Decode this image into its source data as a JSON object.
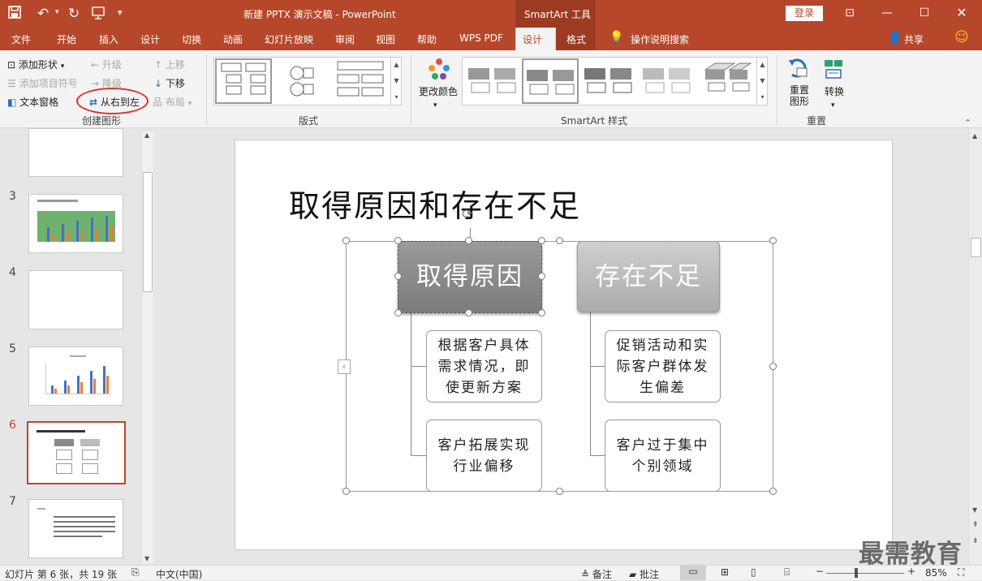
{
  "titlebar": {
    "document_title": "新建 PPTX 演示文稿  -  PowerPoint",
    "context_group": "SmartArt 工具",
    "login": "登录"
  },
  "tabs": [
    "文件",
    "开始",
    "插入",
    "设计",
    "切换",
    "动画",
    "幻灯片放映",
    "审阅",
    "视图",
    "帮助",
    "WPS PDF",
    "设计",
    "格式"
  ],
  "tell_me": "操作说明搜索",
  "share": "共享",
  "ribbon": {
    "create": {
      "add_shape": "添加形状",
      "add_bullet": "添加项目符号",
      "text_pane": "文本窗格",
      "promote": "升级",
      "demote": "降级",
      "rtl": "从右到左",
      "move_up": "上移",
      "move_down": "下移",
      "layout": "布局",
      "label": "创建图形"
    },
    "layouts_label": "版式",
    "change_colors": "更改颜色",
    "styles_label": "SmartArt 样式",
    "reset_graphic": "重置图形",
    "reset_graphic_l1": "重置",
    "reset_graphic_l2": "图形",
    "convert": "转换",
    "reset_label": "重置"
  },
  "thumbnails": [
    {
      "num": "3"
    },
    {
      "num": "4"
    },
    {
      "num": "5"
    },
    {
      "num": "6"
    },
    {
      "num": "7"
    }
  ],
  "slide": {
    "title": "取得原因和存在不足",
    "col1_header": "取得原因",
    "col2_header": "存在不足",
    "col1_items": [
      "根据客户具体需求情况，即使更新方案",
      "客户拓展实现行业偏移"
    ],
    "col2_items": [
      "促销活动和实际客户群体发生偏差",
      "客户过于集中个别领域"
    ]
  },
  "status": {
    "slide_info": "幻灯片 第 6 张，共 19 张",
    "language": "中文(中国)",
    "notes": "备注",
    "comments": "批注",
    "zoom": "85%"
  },
  "watermark": "最需教育",
  "colors": {
    "accent": "#b7472a",
    "rtl_circle": "#e03030"
  }
}
